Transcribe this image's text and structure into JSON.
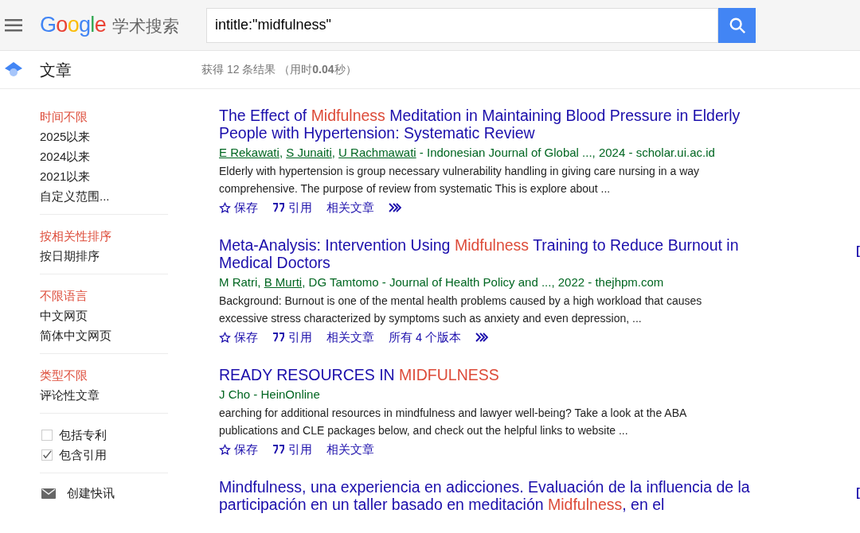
{
  "header": {
    "logo": "Google",
    "logo_suffix": "学术搜索",
    "search": {
      "value": "intitle:\"midfulness\""
    }
  },
  "subheader": {
    "section": "文章",
    "stats": "获得 12 条结果 （用时**0.04**秒）"
  },
  "sidebar": {
    "groups": [
      {
        "items": [
          {
            "label": "时间不限",
            "selected": true
          },
          {
            "label": "2025以来",
            "selected": false
          },
          {
            "label": "2024以来",
            "selected": false
          },
          {
            "label": "2021以来",
            "selected": false
          },
          {
            "label": "自定义范围...",
            "selected": false
          }
        ]
      },
      {
        "items": [
          {
            "label": "按相关性排序",
            "selected": true
          },
          {
            "label": "按日期排序",
            "selected": false
          }
        ]
      },
      {
        "items": [
          {
            "label": "不限语言",
            "selected": true
          },
          {
            "label": "中文网页",
            "selected": false
          },
          {
            "label": "简体中文网页",
            "selected": false
          }
        ]
      },
      {
        "items": [
          {
            "label": "类型不限",
            "selected": true
          },
          {
            "label": "评论性文章",
            "selected": false
          }
        ]
      }
    ],
    "checkboxes": [
      {
        "label": "包括专利",
        "checked": false
      },
      {
        "label": "包含引用",
        "checked": true
      }
    ],
    "alert": "创建快讯"
  },
  "results": [
    {
      "title": [
        {
          "text": "The Effect of ",
          "highlight": false
        },
        {
          "text": "Midfulness",
          "highlight": true
        },
        {
          "text": " Meditation in Maintaining Blood Pressure in Elderly People with Hypertension: Systematic Review",
          "highlight": false
        }
      ],
      "authors": [
        {
          "name": "E Rekawati",
          "linked": true
        },
        {
          "sep": ", ",
          "name": "S Junaiti",
          "linked": true
        },
        {
          "sep": ", ",
          "name": "U Rachmawati",
          "linked": true
        }
      ],
      "source": " - Indonesian Journal of Global ..., 2024 - scholar.ui.ac.id",
      "snippet": "Elderly with hypertension is group necessary vulnerability handling in giving care nursing in a way comprehensive. The purpose of review from systematic This is explore about ...",
      "actions": [
        {
          "kind": "save",
          "label": "保存"
        },
        {
          "kind": "cite",
          "label": "引用"
        },
        {
          "kind": "plain",
          "label": "相关文章"
        },
        {
          "kind": "more"
        }
      ]
    },
    {
      "title": [
        {
          "text": "Meta-Analysis: Intervention Using ",
          "highlight": false
        },
        {
          "text": "Midfulness",
          "highlight": true
        },
        {
          "text": " Training to Reduce Burnout in Medical Doctors",
          "highlight": false
        }
      ],
      "side_label": "[",
      "authors": [
        {
          "name": "M Ratri",
          "linked": false
        },
        {
          "sep": ", ",
          "name": "B Murti",
          "linked": true
        },
        {
          "sep": ", ",
          "name": "DG Tamtomo",
          "linked": false
        }
      ],
      "source": " - Journal of Health Policy and ..., 2022 - thejhpm.com",
      "snippet": "Background: Burnout is one of the mental health problems caused by a high workload that causes excessive stress characterized by symptoms such as anxiety and even depression, ...",
      "actions": [
        {
          "kind": "save",
          "label": "保存"
        },
        {
          "kind": "cite",
          "label": "引用"
        },
        {
          "kind": "plain",
          "label": "相关文章"
        },
        {
          "kind": "plain",
          "label": "所有 4 个版本"
        },
        {
          "kind": "more"
        }
      ]
    },
    {
      "title": [
        {
          "text": "READY RESOURCES IN ",
          "highlight": false
        },
        {
          "text": "MIDFULNESS",
          "highlight": true
        }
      ],
      "authors": [
        {
          "name": "J Cho",
          "linked": false
        }
      ],
      "source": " - HeinOnline",
      "snippet": "earching for additional resources in mindfulness and lawyer well-being? Take a look at the ABA publications and CLE packages below, and check out the helpful links to website ...",
      "actions": [
        {
          "kind": "save",
          "label": "保存"
        },
        {
          "kind": "cite",
          "label": "引用"
        },
        {
          "kind": "plain",
          "label": "相关文章"
        }
      ]
    },
    {
      "title": [
        {
          "text": "Mindfulness, una experiencia en adicciones. Evaluación de la influencia de la participación en un taller basado en meditación ",
          "highlight": false
        },
        {
          "text": "Midfulness",
          "highlight": true
        },
        {
          "text": ", en el",
          "highlight": false
        }
      ],
      "side_label": "["
    }
  ]
}
